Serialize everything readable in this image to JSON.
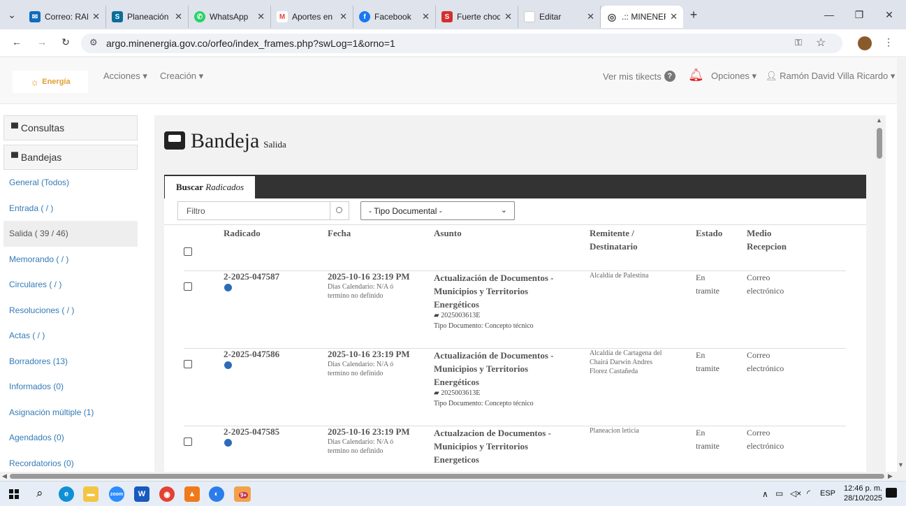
{
  "browser": {
    "tabs": [
      {
        "title": "Correo: RAM",
        "fav_color": "#0f6cbd",
        "fav_glyph": "✉"
      },
      {
        "title": "Planeación e",
        "fav_color": "#0b6e99",
        "fav_glyph": "S"
      },
      {
        "title": "WhatsApp",
        "fav_color": "#25d366",
        "fav_glyph": "W"
      },
      {
        "title": "Aportes en L",
        "fav_color": "#ea4335",
        "fav_glyph": "M"
      },
      {
        "title": "Facebook",
        "fav_color": "#1877f2",
        "fav_glyph": "f"
      },
      {
        "title": "Fuerte choqu",
        "fav_color": "#d32f2f",
        "fav_glyph": "S"
      },
      {
        "title": "Editar",
        "fav_color": "#ffffff",
        "fav_glyph": ""
      },
      {
        "title": ".:: MINENER",
        "fav_color": "#555555",
        "fav_glyph": "◎",
        "active": true
      }
    ],
    "url": "argo.minenergia.gov.co/orfeo/index_frames.php?swLog=1&orno=1"
  },
  "topnav": {
    "logo_text": "Energía",
    "acciones": "Acciones ▾",
    "creacion": "Creación ▾",
    "ver_tickets": "Ver mis tikects",
    "opciones": "Opciones ▾",
    "user": "Ramón David Villa Ricardo ▾"
  },
  "sidebar": {
    "consultas": "Consultas",
    "bandejas": "Bandejas",
    "items": [
      {
        "label": "General (Todos)"
      },
      {
        "label": "Entrada ( / )"
      },
      {
        "label": "Salida ( 39 / 46)",
        "selected": true
      },
      {
        "label": "Memorando ( / )"
      },
      {
        "label": "Circulares ( / )"
      },
      {
        "label": "Resoluciones ( / )"
      },
      {
        "label": "Actas ( / )"
      },
      {
        "label": "Borradores (13)"
      },
      {
        "label": "Informados (0)"
      },
      {
        "label": "Asignación múltiple (1)"
      },
      {
        "label": "Agendados (0)"
      },
      {
        "label": "Recordatorios (0)"
      }
    ]
  },
  "main": {
    "title": "Bandeja",
    "subtitle": "Salida",
    "tab_buscar": "Buscar",
    "tab_radicados": "Radicados",
    "filter_placeholder": "Filtro",
    "tipo_documental": "- Tipo Documental -",
    "columns": {
      "radicado": "Radicado",
      "fecha": "Fecha",
      "asunto": "Asunto",
      "remitente_1": "Remitente /",
      "remitente_2": "Destinatario",
      "estado": "Estado",
      "medio_1": "Medio",
      "medio_2": "Recepcion"
    },
    "rows": [
      {
        "radicado": "2-2025-047587",
        "fecha": "2025-10-16 23:19 PM",
        "dias_1": "Dias Calendario: N/A ó",
        "dias_2": "termino no definido",
        "asunto_1": "Actualización de Documentos -",
        "asunto_2": "Municipios y Territorios",
        "asunto_3": "Energéticos",
        "expediente": "2025003613E",
        "tipo_doc": "Tipo Documento: Concepto técnico",
        "remitente_1": "Alcaldía de Palestina",
        "remitente_2": "",
        "remitente_3": "",
        "estado_1": "En",
        "estado_2": "tramite",
        "medio_1": "Correo",
        "medio_2": "electrónico"
      },
      {
        "radicado": "2-2025-047586",
        "fecha": "2025-10-16 23:19 PM",
        "dias_1": "Dias Calendario: N/A ó",
        "dias_2": "termino no definido",
        "asunto_1": "Actualización de Documentos -",
        "asunto_2": "Municipios y Territorios",
        "asunto_3": "Energéticos",
        "expediente": "2025003613E",
        "tipo_doc": "Tipo Documento: Concepto técnico",
        "remitente_1": "Alcaldía de Cartagena del",
        "remitente_2": "Chairá Darwin Andres",
        "remitente_3": "Florez Castañeda",
        "estado_1": "En",
        "estado_2": "tramite",
        "medio_1": "Correo",
        "medio_2": "electrónico"
      },
      {
        "radicado": "2-2025-047585",
        "fecha": "2025-10-16 23:19 PM",
        "dias_1": "Dias Calendario: N/A ó",
        "dias_2": "termino no definido",
        "asunto_1": "Actualzacion de Documentos -",
        "asunto_2": "Municipios y Territorios",
        "asunto_3": "Energeticos",
        "expediente": "",
        "tipo_doc": "",
        "remitente_1": "Planeacion leticia",
        "remitente_2": "",
        "remitente_3": "",
        "estado_1": "En",
        "estado_2": "tramite",
        "medio_1": "Correo",
        "medio_2": "electrónico"
      }
    ]
  },
  "taskbar": {
    "lang": "ESP",
    "time": "12:46 p. m.",
    "date": "28/10/2025",
    "teams_badge": "9+"
  }
}
